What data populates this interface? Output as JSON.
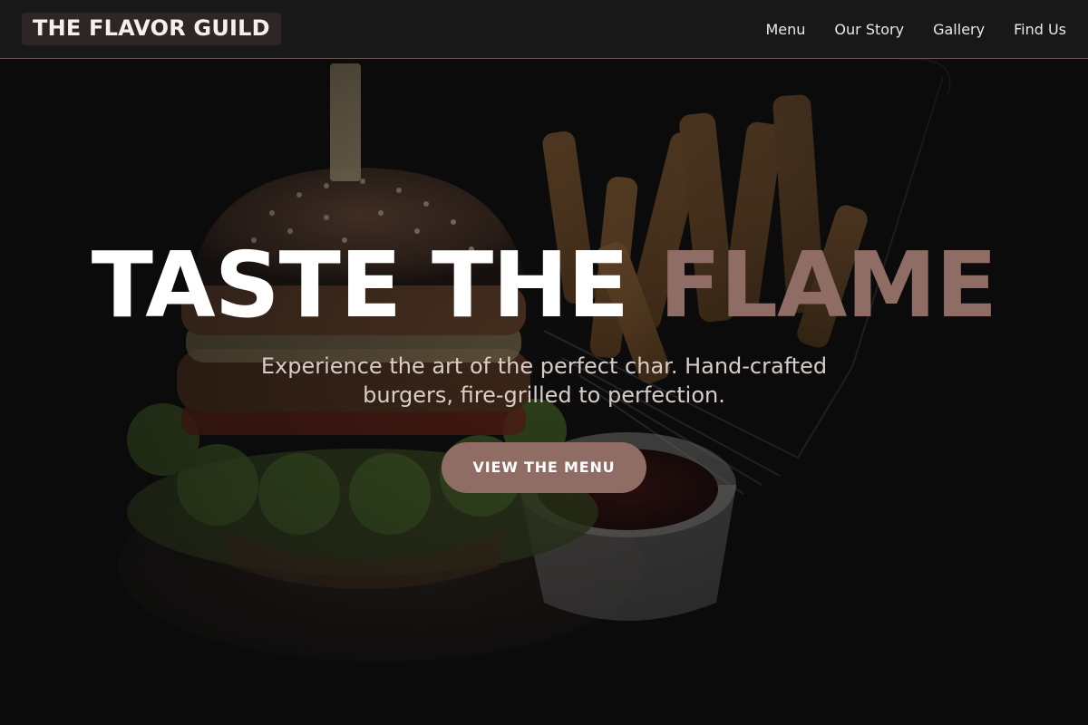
{
  "brand": {
    "logo_text": "THE FLAVOR GUILD"
  },
  "nav": {
    "items": [
      {
        "label": "Menu"
      },
      {
        "label": "Our Story"
      },
      {
        "label": "Gallery"
      },
      {
        "label": "Find Us"
      }
    ]
  },
  "hero": {
    "title_main": "TASTE THE",
    "title_accent": "FLAME",
    "subtitle": "Experience the art of the perfect char. Hand-crafted burgers, fire-grilled to perfection.",
    "cta_label": "VIEW THE MENU"
  },
  "colors": {
    "accent": "#8f6d64",
    "nav_background": "#191818",
    "logo_background": "#302525",
    "page_background": "#0e0d0d"
  },
  "images": {
    "hero_background": "burger-and-fries-photo"
  }
}
